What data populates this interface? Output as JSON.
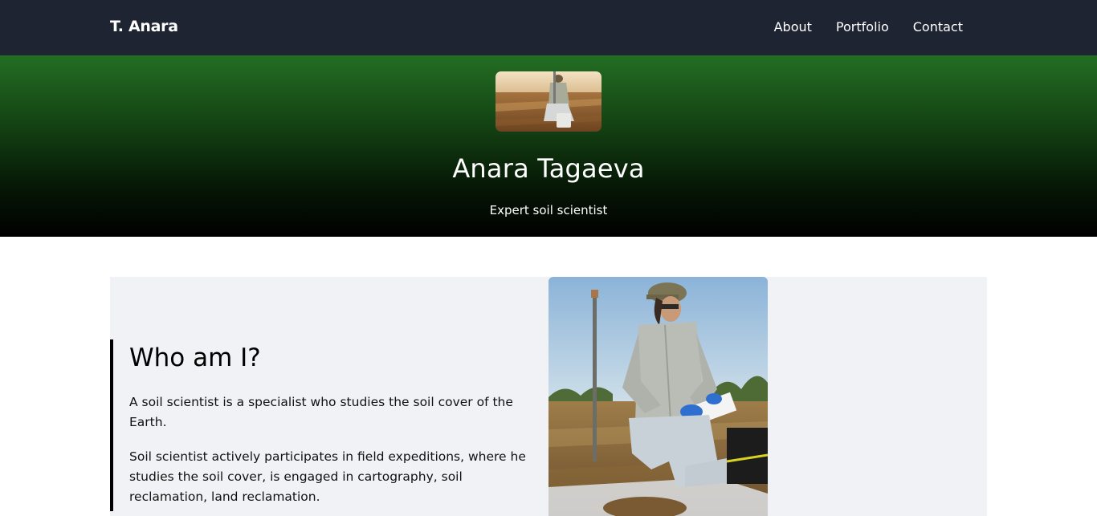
{
  "nav": {
    "brand": "T. Anara",
    "links": [
      {
        "label": "About"
      },
      {
        "label": "Portfolio"
      },
      {
        "label": "Contact"
      }
    ]
  },
  "hero": {
    "name": "Anara Tagaeva",
    "subtitle": "Expert soil scientist"
  },
  "about": {
    "title": "Who am I?",
    "paragraphs": [
      "A soil scientist is a specialist who studies the soil cover of the Earth.",
      "Soil scientist actively participates in field expeditions, where he studies the soil cover, is engaged in cartography, soil reclamation, land reclamation."
    ]
  },
  "colors": {
    "nav_bg": "#1f2433",
    "hero_green": "#236e23",
    "section_bg": "#f1f2f6",
    "accent_border": "#000000"
  }
}
